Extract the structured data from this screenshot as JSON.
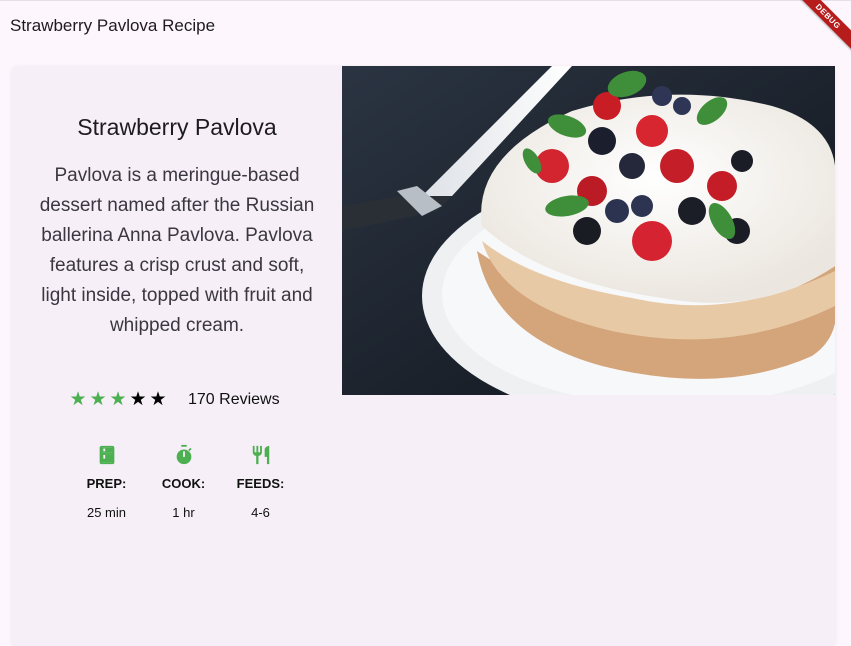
{
  "appbar": {
    "title": "Strawberry Pavlova Recipe"
  },
  "debug_banner": "DEBUG",
  "recipe": {
    "title": "Strawberry Pavlova",
    "description": "Pavlova is a meringue-based dessert named after the Russian ballerina Anna Pavlova. Pavlova features a crisp crust and soft, light inside, topped with fruit and whipped cream.",
    "rating": 3,
    "max_rating": 5,
    "reviews": "170 Reviews"
  },
  "stats": [
    {
      "icon": "kitchen-icon",
      "label": "PREP:",
      "value": "25 min"
    },
    {
      "icon": "timer-icon",
      "label": "COOK:",
      "value": "1 hr"
    },
    {
      "icon": "restaurant-icon",
      "label": "FEEDS:",
      "value": "4-6"
    }
  ],
  "colors": {
    "accent": "#4caf50",
    "background": "#fdf7fd",
    "card": "#f6eff8"
  }
}
